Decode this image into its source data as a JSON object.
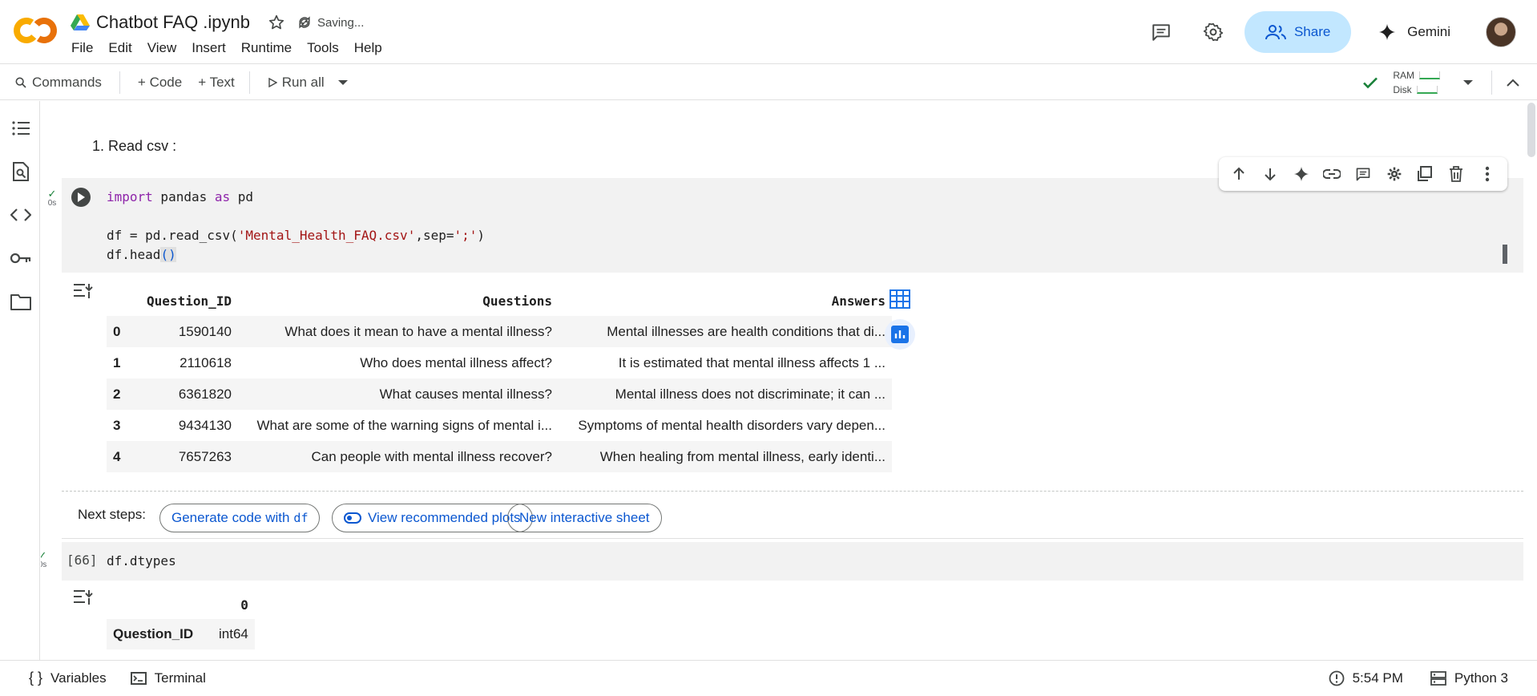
{
  "header": {
    "notebook_title": "Chatbot FAQ .ipynb",
    "saving_status": "Saving...",
    "menu": [
      "File",
      "Edit",
      "View",
      "Insert",
      "Runtime",
      "Tools",
      "Help"
    ],
    "share_label": "Share",
    "gemini_label": "Gemini"
  },
  "toolbar": {
    "commands_label": "Commands",
    "code_label": "+ Code",
    "text_label": "+ Text",
    "run_all_label": "Run all",
    "ram_label": "RAM",
    "disk_label": "Disk"
  },
  "cells": {
    "markdown": {
      "list_number": "1.",
      "text": "Read csv :"
    },
    "cell1": {
      "exec_time": "0s",
      "code_line1_kw": "import",
      "code_line1_mid": " pandas ",
      "code_line1_kw2": "as",
      "code_line1_end": " pd",
      "code_line2_pre": "df = pd.read_csv(",
      "code_line2_str1": "'Mental_Health_FAQ.csv'",
      "code_line2_mid": ",sep=",
      "code_line2_str2": "';'",
      "code_line2_end": ")",
      "code_line3_pre": "df.head",
      "code_line3_paren": "()"
    },
    "dataframe": {
      "columns": [
        "",
        "Question_ID",
        "Questions",
        "Answers"
      ],
      "rows": [
        [
          "0",
          "1590140",
          "What does it mean to have a mental illness?",
          "Mental illnesses are health conditions that di..."
        ],
        [
          "1",
          "2110618",
          "Who does mental illness affect?",
          "It is estimated that mental illness affects 1 ..."
        ],
        [
          "2",
          "6361820",
          "What causes mental illness?",
          "Mental illness does not discriminate; it can ..."
        ],
        [
          "3",
          "9434130",
          "What are some of the warning signs of mental i...",
          "Symptoms of mental health disorders vary depen..."
        ],
        [
          "4",
          "7657263",
          "Can people with mental illness recover?",
          "When healing from mental illness, early identi..."
        ]
      ]
    },
    "next_steps": {
      "label": "Next steps:",
      "chip1_text": "Generate code with",
      "chip1_code": "df",
      "chip2": "View recommended plots",
      "chip3": "New interactive sheet"
    },
    "cell2": {
      "exec_time": "0s",
      "exec_count": "[66]",
      "code": "df.dtypes",
      "col_header": "0",
      "row_label": "Question_ID",
      "row_value": "int64"
    }
  },
  "statusbar": {
    "variables_label": "Variables",
    "terminal_label": "Terminal",
    "time": "5:54 PM",
    "kernel": "Python 3"
  },
  "colors": {
    "accent": "#0b57d0",
    "share_bg": "#c2e7ff",
    "logo_orange": "#f9ab00",
    "success_green": "#188038"
  }
}
